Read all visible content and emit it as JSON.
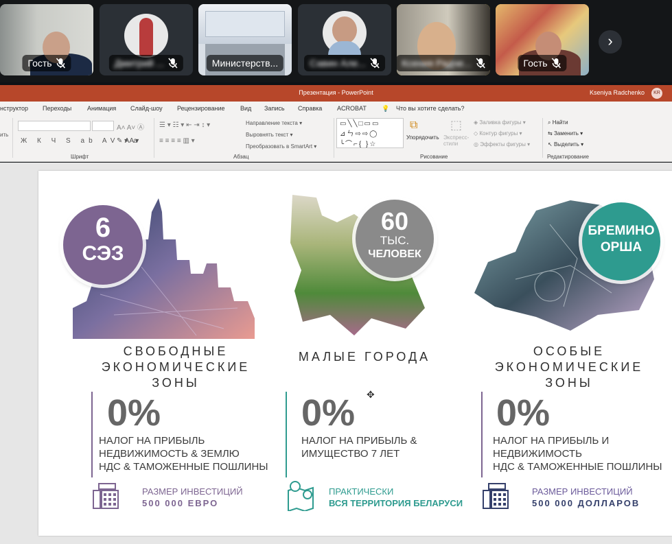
{
  "meeting": {
    "participants": [
      {
        "label": "Гость",
        "muted": true
      },
      {
        "label": "Дмитрий ...",
        "muted": true,
        "blurred": true
      },
      {
        "label": "Министерств...",
        "muted": false
      },
      {
        "label": "Савин Але...",
        "muted": true,
        "blurred": true
      },
      {
        "label": "Ксения Радче...",
        "muted": true,
        "blurred": true,
        "active": true
      },
      {
        "label": "Гость",
        "muted": true
      }
    ],
    "next_icon": "›"
  },
  "ppt": {
    "window_title": "Презентация - PowerPoint",
    "user_name": "Kseniya Radchenko",
    "user_initials": "KR",
    "tabs": [
      "нструктор",
      "Переходы",
      "Анимация",
      "Слайд-шоу",
      "Рецензирование",
      "Вид",
      "Запись",
      "Справка",
      "ACROBAT",
      "Что вы хотите сделать?"
    ],
    "ribbon": {
      "font_group": "Шрифт",
      "paragraph_group": "Абзац",
      "drawing_group": "Рисование",
      "editing_group": "Редактирование",
      "text_direction": "Направление текста",
      "align_text": "Выровнять текст",
      "smartart": "Преобразовать в SmartArt",
      "arrange": "Упорядочить",
      "quick_styles": "Экспресс-стили",
      "shape_fill": "Заливка фигуры",
      "shape_outline": "Контур фигуры",
      "shape_effects": "Эффекты фигуры",
      "find": "Найти",
      "replace": "Заменить",
      "select": "Выделить",
      "left_stub": "ить"
    }
  },
  "slide": {
    "colors": {
      "purple": "#7d6591",
      "gray": "#8a8a8a",
      "teal": "#2e9b8f",
      "navy": "#35406b"
    },
    "columns": [
      {
        "badge_line1": "6",
        "badge_line2": "СЭЗ",
        "title": [
          "СВОБОДНЫЕ",
          "ЭКОНОМИЧЕСКИЕ",
          "ЗОНЫ"
        ],
        "percent": "0%",
        "desc": [
          "НАЛОГ НА ПРИБЫЛЬ",
          "НЕДВИЖИМОСТЬ & ЗЕМЛЮ",
          "НДС & ТАМОЖЕННЫЕ ПОШЛИНЫ"
        ],
        "inv_label": "РАЗМЕР ИНВЕСТИЦИЙ",
        "inv_value": "500 000 ЕВРО",
        "icon": "calculator-icon"
      },
      {
        "badge_line1": "60",
        "badge_line2": "ТЫС.",
        "badge_line3": "ЧЕЛОВЕК",
        "title": [
          "МАЛЫЕ ГОРОДА"
        ],
        "percent": "0%",
        "desc": [
          "НАЛОГ НА ПРИБЫЛЬ &",
          "ИМУЩЕСТВО 7 ЛЕТ"
        ],
        "inv_label": "ПРАКТИЧЕСКИ",
        "inv_value": "ВСЯ ТЕРРИТОРИЯ БЕЛАРУСИ",
        "icon": "map-pin-icon"
      },
      {
        "badge_line1": "БРЕМИНО",
        "badge_line2": "ОРША",
        "title": [
          "ОСОБЫЕ",
          "ЭКОНОМИЧЕСКИЕ",
          "ЗОНЫ"
        ],
        "percent": "0%",
        "desc": [
          "НАЛОГ НА ПРИБЫЛЬ И",
          "НЕДВИЖИМОСТЬ",
          "НДС & ТАМОЖЕННЫЕ ПОШЛИНЫ"
        ],
        "inv_label": "РАЗМЕР ИНВЕСТИЦИЙ",
        "inv_value": "500 000 ДОЛЛАРОВ",
        "icon": "calculator-icon"
      }
    ]
  }
}
